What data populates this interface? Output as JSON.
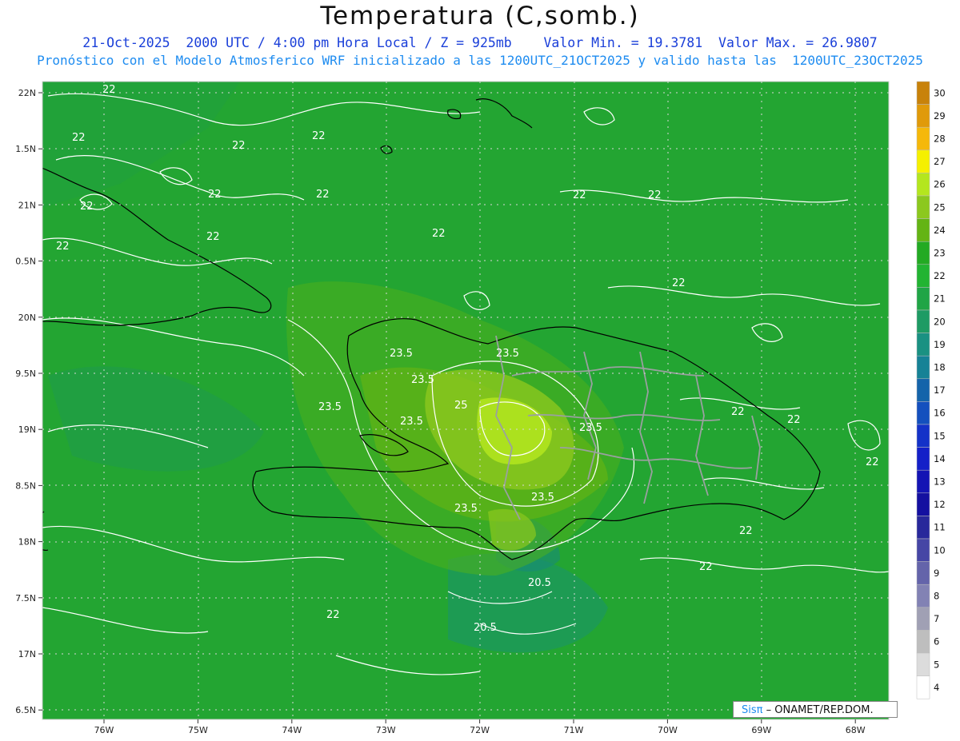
{
  "header": {
    "title": "Temperatura (C,somb.)",
    "line1": "21-Oct-2025  2000 UTC / 4:00 pm Hora Local / Z = 925mb    Valor Min. = 19.3781  Valor Max. = 26.9807",
    "line2": "Pronóstico con el Modelo Atmosferico WRF inicializado a las 1200UTC_21OCT2025 y valido hasta las  1200UTC_23OCT2025"
  },
  "axes": {
    "lon_labels": [
      "76W",
      "75W",
      "74W",
      "73W",
      "72W",
      "71W",
      "70W",
      "69W",
      "68W"
    ],
    "lat_labels": [
      "22N",
      "1.5N",
      "21N",
      "0.5N",
      "20N",
      "9.5N",
      "19N",
      "8.5N",
      "18N",
      "7.5N",
      "17N",
      "6.5N"
    ]
  },
  "colorbar": {
    "levels": [
      "30",
      "29",
      "28",
      "27",
      "26",
      "25",
      "24",
      "23",
      "22",
      "21",
      "20",
      "19",
      "18",
      "17",
      "16",
      "15",
      "14",
      "13",
      "12",
      "11",
      "10",
      "9",
      "8",
      "7",
      "6",
      "5",
      "4"
    ],
    "colors": [
      "#c8820a",
      "#e09a0a",
      "#f5b80a",
      "#f5f000",
      "#b4e61e",
      "#8cc81e",
      "#64b414",
      "#23aa23",
      "#22b432",
      "#20a546",
      "#1e9b64",
      "#1a9182",
      "#168296",
      "#1464aa",
      "#1450be",
      "#1432c8",
      "#1420c8",
      "#1414b4",
      "#1410a0",
      "#28289b",
      "#4646a5",
      "#6464aa",
      "#8282b4",
      "#a0a0b4",
      "#bebebe",
      "#dcdcdc",
      "#ffffff"
    ]
  },
  "contour_labels": [
    {
      "text": "22"
    },
    {
      "text": "22"
    },
    {
      "text": "22"
    },
    {
      "text": "22"
    },
    {
      "text": "22"
    },
    {
      "text": "22"
    },
    {
      "text": "22"
    },
    {
      "text": "22"
    },
    {
      "text": "22"
    },
    {
      "text": "22"
    },
    {
      "text": "23.5"
    },
    {
      "text": "23.5"
    },
    {
      "text": "23.5"
    },
    {
      "text": "23.5"
    },
    {
      "text": "25"
    },
    {
      "text": "23.5"
    },
    {
      "text": "23.5"
    },
    {
      "text": "23.5"
    },
    {
      "text": "23.5"
    },
    {
      "text": "20.5"
    },
    {
      "text": "20.5"
    },
    {
      "text": "22"
    },
    {
      "text": "22"
    },
    {
      "text": "22"
    },
    {
      "text": "22"
    },
    {
      "text": "22"
    },
    {
      "text": "22"
    },
    {
      "text": "22"
    },
    {
      "text": "22"
    },
    {
      "text": "22"
    }
  ],
  "credit": {
    "brand": "Sisπ",
    "text": "– ONAMET/REP.DOM."
  },
  "colors": {
    "map_base": "#23a532",
    "title_blue": "#1a3fd9",
    "subtitle_blue": "#1e8cf0"
  }
}
